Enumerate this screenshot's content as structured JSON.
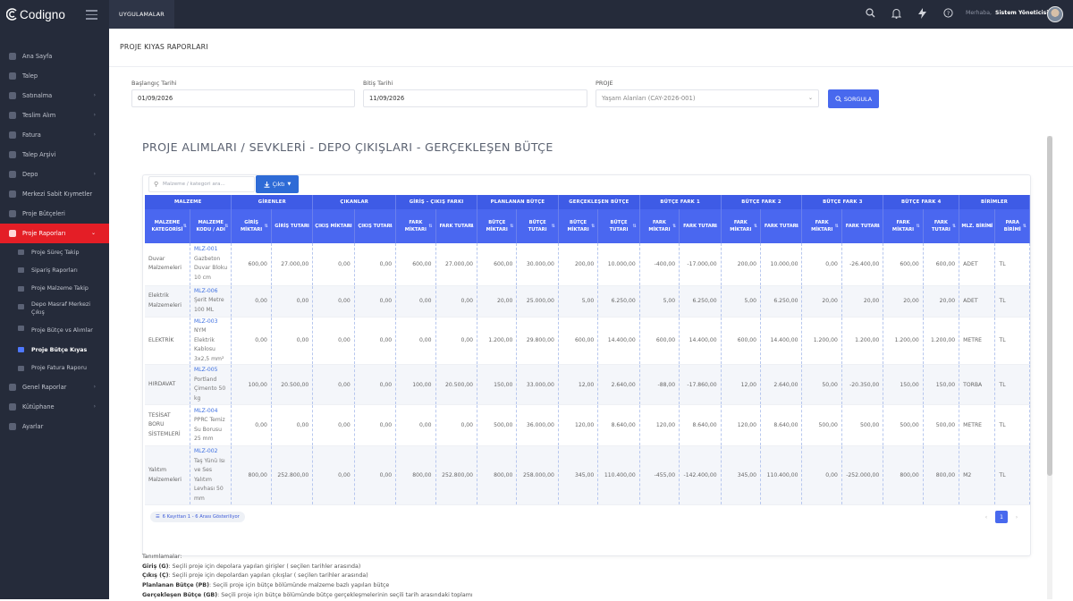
{
  "app": {
    "name": "Codigno"
  },
  "topbar": {
    "apps_label": "UYGULAMALAR",
    "greeting": "Merhaba,",
    "user_name": "Sistem Yöneticisi"
  },
  "sidebar": {
    "items": [
      {
        "label": "Ana Sayfa",
        "has_children": false
      },
      {
        "label": "Talep",
        "has_children": false
      },
      {
        "label": "Satınalma",
        "has_children": true
      },
      {
        "label": "Teslim Alım",
        "has_children": true
      },
      {
        "label": "Fatura",
        "has_children": true
      },
      {
        "label": "Talep Arşivi",
        "has_children": false
      },
      {
        "label": "Depo",
        "has_children": true
      },
      {
        "label": "Merkezi Sabit Kıymetler",
        "has_children": false
      },
      {
        "label": "Proje Bütçeleri",
        "has_children": false
      },
      {
        "label": "Proje Raporları",
        "has_children": true,
        "active": true
      }
    ],
    "subitems": [
      {
        "label": "Proje Süreç Takip"
      },
      {
        "label": "Sipariş Raporları"
      },
      {
        "label": "Proje Malzeme Takip"
      },
      {
        "label": "Depo Masraf Merkezi Çıkış"
      },
      {
        "label": "Proje Bütçe vs Alımlar"
      },
      {
        "label": "Proje Bütçe Kıyas",
        "current": true
      },
      {
        "label": "Proje Fatura Raporu"
      }
    ],
    "items_after": [
      {
        "label": "Genel Raporlar",
        "has_children": true
      },
      {
        "label": "Kütüphane",
        "has_children": true
      },
      {
        "label": "Ayarlar",
        "has_children": false
      }
    ]
  },
  "page": {
    "title": "PROJE KIYAS RAPORLARI"
  },
  "filters": {
    "start_label": "Başlangıç Tarihi",
    "start_value": "01/09/2026",
    "end_label": "Bitiş Tarihi",
    "end_value": "11/09/2026",
    "project_label": "PROJE",
    "project_value": "Yaşam Alanları (CAY-2026-001)",
    "query_button": "SORGULA"
  },
  "report": {
    "title": "PROJE ALIMLARI / SEVKLERİ - DEPO ÇIKIŞLARI - GERÇEKLEŞEN BÜTÇE",
    "search_placeholder": "Malzeme / kategori ara...",
    "export_label": "Çıktı",
    "group_headers": [
      "MALZEME",
      "GİRENLER",
      "ÇIKANLAR",
      "GİRİŞ - ÇIKIŞ FARKI",
      "PLANLANAN BÜTÇE",
      "GERÇEKLEŞEN BÜTÇE",
      "BÜTÇE FARK 1",
      "BÜTÇE FARK 2",
      "BÜTÇE FARK 3",
      "BÜTÇE FARK 4",
      "BİRİMLER"
    ],
    "column_headers": [
      "MALZEME KATEGORİSİ",
      "MALZEME KODU / ADI",
      "GİRİŞ MİKTARI",
      "GİRİŞ TUTARI",
      "ÇIKIŞ MİKTARI",
      "ÇIKIŞ TUTARI",
      "FARK MİKTARI",
      "FARK TUTARI",
      "BÜTÇE MİKTARI",
      "BÜTÇE TUTARI",
      "BÜTÇE MİKTARI",
      "BÜTÇE TUTARI",
      "FARK MİKTARI",
      "FARK TUTARI",
      "FARK MİKTARI",
      "FARK TUTARI",
      "FARK MİKTARI",
      "FARK TUTARI",
      "FARK MİKTARI",
      "FARK TUTARI",
      "MLZ. BİRİMİ",
      "PARA BİRİMİ"
    ],
    "rows": [
      {
        "category": "Duvar Malzemeleri",
        "code": "MLZ-001",
        "name": "Gazbeton Duvar Bloku 10 cm",
        "values": [
          "600,00",
          "27.000,00",
          "0,00",
          "0,00",
          "600,00",
          "27.000,00",
          "600,00",
          "30.000,00",
          "200,00",
          "10.000,00",
          "-400,00",
          "-17.000,00",
          "200,00",
          "10.000,00",
          "0,00",
          "-26.400,00",
          "600,00",
          "600,00"
        ],
        "unit": "ADET",
        "currency": "TL"
      },
      {
        "category": "Elektrik Malzemeleri",
        "code": "MLZ-006",
        "name": "Şerit Metre 100 ML",
        "values": [
          "0,00",
          "0,00",
          "0,00",
          "0,00",
          "0,00",
          "0,00",
          "20,00",
          "25.000,00",
          "5,00",
          "6.250,00",
          "5,00",
          "6.250,00",
          "5,00",
          "6.250,00",
          "20,00",
          "20,00",
          "20,00",
          "20,00"
        ],
        "unit": "ADET",
        "currency": "TL"
      },
      {
        "category": "ELEKTRİK",
        "code": "MLZ-003",
        "name": "NYM Elektrik Kablosu 3x2,5 mm²",
        "values": [
          "0,00",
          "0,00",
          "0,00",
          "0,00",
          "0,00",
          "0,00",
          "1.200,00",
          "29.800,00",
          "600,00",
          "14.400,00",
          "600,00",
          "14.400,00",
          "600,00",
          "14.400,00",
          "1.200,00",
          "1.200,00",
          "1.200,00",
          "1.200,00"
        ],
        "unit": "METRE",
        "currency": "TL"
      },
      {
        "category": "HIRDAVAT",
        "code": "MLZ-005",
        "name": "Portland Çimento 50 kg",
        "values": [
          "100,00",
          "20.500,00",
          "0,00",
          "0,00",
          "100,00",
          "20.500,00",
          "150,00",
          "33.000,00",
          "12,00",
          "2.640,00",
          "-88,00",
          "-17.860,00",
          "12,00",
          "2.640,00",
          "50,00",
          "-20.350,00",
          "150,00",
          "150,00"
        ],
        "unit": "TORBA",
        "currency": "TL"
      },
      {
        "category": "TESİSAT BORU SİSTEMLERİ",
        "code": "MLZ-004",
        "name": "PPRC Temiz Su Borusu 25 mm",
        "values": [
          "0,00",
          "0,00",
          "0,00",
          "0,00",
          "0,00",
          "0,00",
          "500,00",
          "36.000,00",
          "120,00",
          "8.640,00",
          "120,00",
          "8.640,00",
          "120,00",
          "8.640,00",
          "500,00",
          "500,00",
          "500,00",
          "500,00"
        ],
        "unit": "METRE",
        "currency": "TL"
      },
      {
        "category": "Yalıtım Malzemeleri",
        "code": "MLZ-002",
        "name": "Taş Yünü Isı ve Ses Yalıtım Levhası 50 mm",
        "values": [
          "800,00",
          "252.800,00",
          "0,00",
          "0,00",
          "800,00",
          "252.800,00",
          "800,00",
          "258.000,00",
          "345,00",
          "110.400,00",
          "-455,00",
          "-142.400,00",
          "345,00",
          "110.400,00",
          "0,00",
          "-252.000,00",
          "800,00",
          "800,00"
        ],
        "unit": "M2",
        "currency": "TL"
      }
    ],
    "pager_info": "6 Kayıttan 1 - 6 Arası Gösteriliyor",
    "pager": {
      "prev": "‹",
      "current": "1",
      "next": "›"
    }
  },
  "definitions": {
    "heading": "Tanımlamalar:",
    "items": [
      {
        "term": "Giriş (G)",
        "text": ": Seçili proje için depolara yapılan girişler ( seçilen tarihler arasında)"
      },
      {
        "term": "Çıkış (Ç)",
        "text": ": Seçili proje için depolardan yapılan çıkışlar ( seçilen tarihler arasında)"
      },
      {
        "term": "Planlanan Bütçe (PB)",
        "text": ": Seçili proje için bütçe bölümünde malzeme bazlı yapılan bütçe"
      },
      {
        "term": "Gerçekleşen Bütçe (GB)",
        "text": ": Seçili proje için bütçe bölümünde bütçe gerçekleşmelerinin seçili tarih arasındaki toplamı"
      }
    ]
  }
}
